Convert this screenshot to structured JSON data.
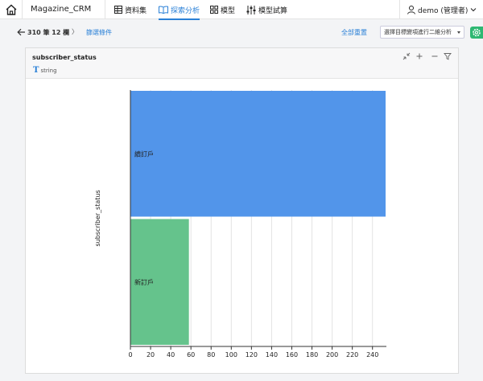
{
  "topbar": {
    "app_title": "Magazine_CRM",
    "nav": [
      {
        "label": "資料集",
        "icon": "table-icon",
        "active": false
      },
      {
        "label": "探索分析",
        "icon": "book-icon",
        "active": true
      },
      {
        "label": "模型",
        "icon": "grid-icon",
        "active": false
      },
      {
        "label": "模型試算",
        "icon": "sliders-icon",
        "active": false
      }
    ],
    "user_label": "demo (管理者)"
  },
  "subbar": {
    "record_info": "310 筆 12 欄",
    "chevron": "〉",
    "filter_label": "篩選條件",
    "reset_label": "全部重置",
    "select_value": "選擇目標變項進行二維分析"
  },
  "card": {
    "title": "subscriber_status",
    "type_label": "string"
  },
  "colors": {
    "accent": "#2a80d7",
    "bar_blue": "#5295ea",
    "bar_green": "#65c38c",
    "gear_green": "#2eb872"
  },
  "chart_data": {
    "type": "bar",
    "orientation": "horizontal",
    "categories": [
      "續訂戶",
      "新訂戶"
    ],
    "values": [
      253,
      58
    ],
    "ylabel": "subscriber_status",
    "xlabel": "",
    "xlim": [
      0,
      253
    ],
    "xticks": [
      0,
      20,
      40,
      60,
      80,
      100,
      120,
      140,
      160,
      180,
      200,
      220,
      240
    ],
    "grid": true
  }
}
